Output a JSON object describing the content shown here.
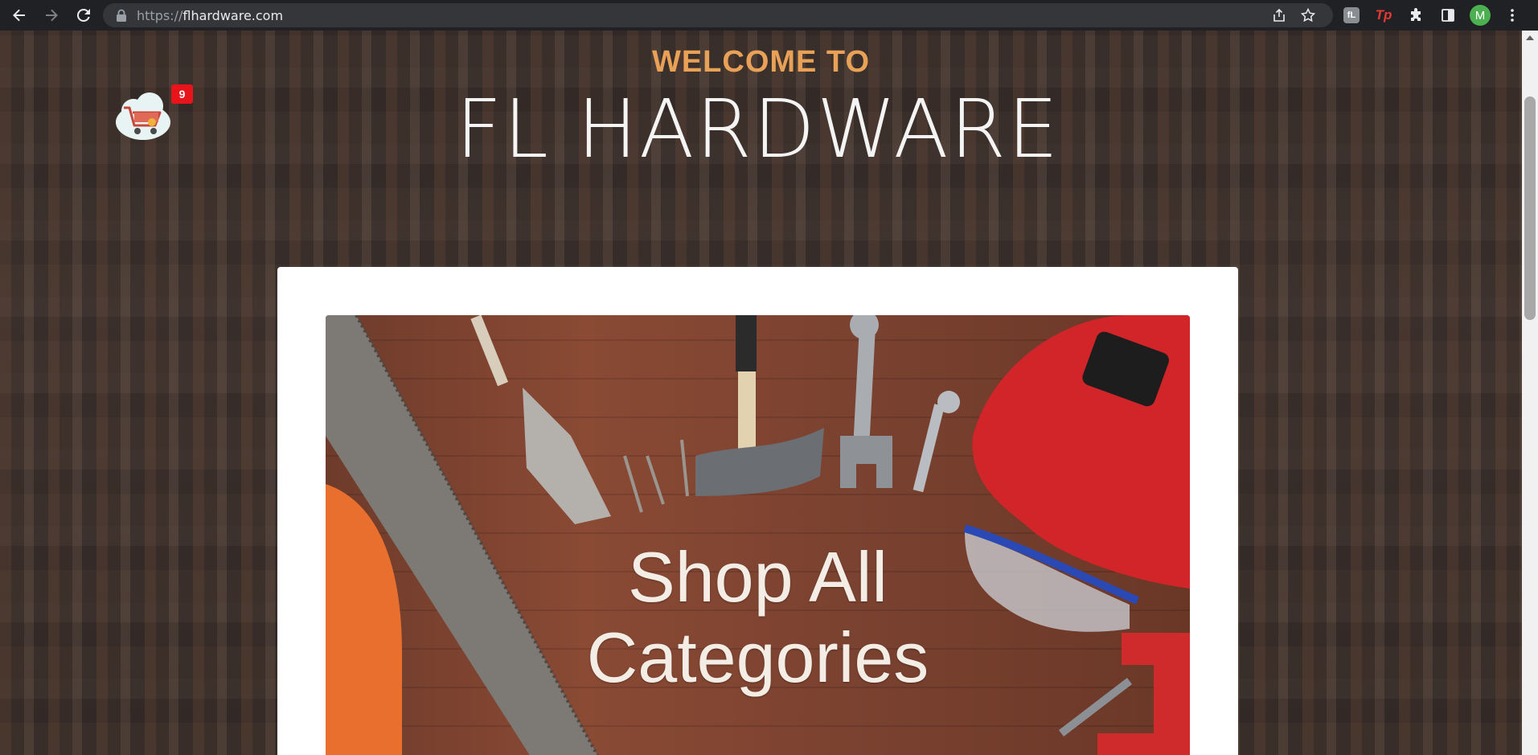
{
  "browser": {
    "url_scheme": "https://",
    "url_host": "flhardware.com",
    "extensions": {
      "fl_label": "fL",
      "tp_label": "Tp"
    },
    "avatar_initial": "M"
  },
  "page": {
    "welcome": "WELCOME TO",
    "brand": "FL HARDWARE",
    "cart": {
      "count": "9",
      "icon": "shopping-cart-cloud-icon"
    },
    "promo": {
      "line1": "Shop All",
      "line2": "Categories"
    }
  },
  "colors": {
    "welcome": "#e9a157",
    "badge": "#e8141a",
    "card": "#ffffff"
  }
}
